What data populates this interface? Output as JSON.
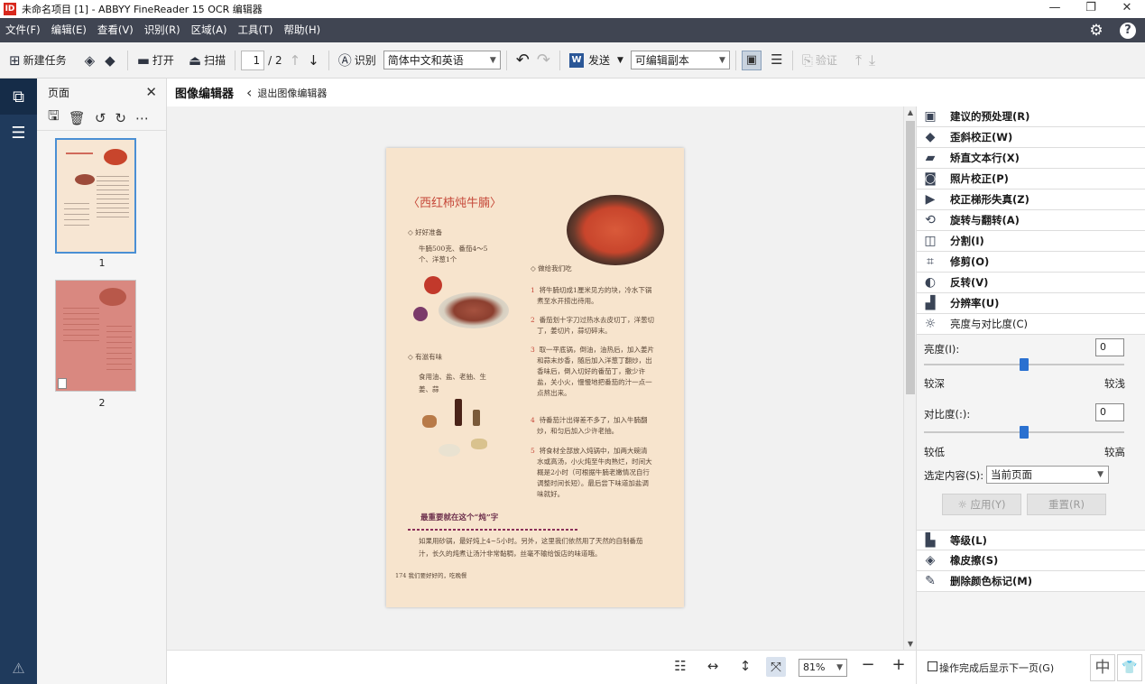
{
  "window": {
    "app_icon_label": "ID",
    "title": "未命名项目 [1] - ABBYY FineReader 15 OCR 编辑器",
    "minimize": "—",
    "restore": "❐",
    "close": "✕"
  },
  "menu": {
    "items": [
      "文件(F)",
      "编辑(E)",
      "查看(V)",
      "识别(R)",
      "区域(A)",
      "工具(T)",
      "帮助(H)"
    ],
    "settings_icon": "gear-icon",
    "help_icon": "help-icon",
    "help_glyph": "?"
  },
  "toolbar": {
    "new_task": "新建任务",
    "open": "打开",
    "scan": "扫描",
    "page_current": "1",
    "page_total": "/ 2",
    "recognize": "识别",
    "language": "简体中文和英语",
    "send": "发送",
    "send_target": "可编辑副本",
    "verify": "验证"
  },
  "pages_panel": {
    "title": "页面",
    "pages": [
      {
        "label": "1",
        "selected": true
      },
      {
        "label": "2",
        "selected": false
      }
    ]
  },
  "editor": {
    "title": "图像编辑器",
    "exit_label": "退出图像编辑器"
  },
  "document": {
    "title": "〈西红柿炖牛腩〉",
    "prep_heading": "◇ 好好准备",
    "prep_text_1": "牛腩500克、番茄4～5",
    "prep_text_2": "个、洋葱1个",
    "steps_heading": "◇ 做给我们吃",
    "seasoning_heading": "◇ 有滋有味",
    "seasoning_text_1": "食用油、盐、老抽、生",
    "seasoning_text_2": "姜、蒜",
    "steps": [
      {
        "n": "1",
        "lines": [
          "将牛腩切成1厘米见方的块，冷水下锅",
          "煮至水开捞出待用。"
        ]
      },
      {
        "n": "2",
        "lines": [
          "番茄划十字刀过热水去皮切丁，洋葱切",
          "丁，姜切片，蒜切碎末。"
        ]
      },
      {
        "n": "3",
        "lines": [
          "取一平底锅，倒油，油热后，加入姜片",
          "和蒜末炒香，随后加入洋葱丁翻炒，出",
          "香味后，倒入切好的番茄丁，撒少许",
          "盐，关小火，慢慢地把番茄的汁一点一",
          "点熬出来。"
        ]
      },
      {
        "n": "4",
        "lines": [
          "待番茄汁出得差不多了，加入牛腩翻",
          "炒，和匀后加入少许老抽。"
        ]
      },
      {
        "n": "5",
        "lines": [
          "将食材全部放入炖锅中，加两大碗清",
          "水或高汤，小火炖至牛肉熟烂，时间大",
          "概是2小时（可根据牛腩老嫩情况自行",
          "调整时间长短）。最后尝下味道加盐调",
          "味就好。"
        ]
      }
    ],
    "tip_heading": "最重要就在这个“炖”字",
    "tip_text_1": "如果用砂锅，最好炖上4~5小时。另外，这里我们依然用了天然的自制番茄",
    "tip_text_2": "汁，长久的炖煮让汤汁非常黏稠，丝毫不输给饭店的味道哦。",
    "footer": "174  我们要好好的，吃晚餐"
  },
  "right_panel": {
    "items_top": [
      {
        "icon": "preprocess-icon",
        "glyph": "▣",
        "label": "建议的预处理(R)"
      },
      {
        "icon": "deskew-icon",
        "glyph": "◆",
        "label": "歪斜校正(W)"
      },
      {
        "icon": "straighten-icon",
        "glyph": "▰",
        "label": "矫直文本行(X)"
      },
      {
        "icon": "camera-icon",
        "glyph": "◙",
        "label": "照片校正(P)"
      },
      {
        "icon": "trapezoid-icon",
        "glyph": "▶",
        "label": "校正梯形失真(Z)"
      },
      {
        "icon": "rotate-icon",
        "glyph": "⟲",
        "label": "旋转与翻转(A)"
      },
      {
        "icon": "split-icon",
        "glyph": "◫",
        "label": "分割(I)"
      },
      {
        "icon": "crop-icon",
        "glyph": "⌗",
        "label": "修剪(O)"
      },
      {
        "icon": "invert-icon",
        "glyph": "◐",
        "label": "反转(V)"
      },
      {
        "icon": "resolution-icon",
        "glyph": "▟",
        "label": "分辨率(U)"
      },
      {
        "icon": "brightness-icon",
        "glyph": "☼",
        "label": "亮度与对比度(C)"
      }
    ],
    "brightness": {
      "label": "亮度(I):",
      "value": "0",
      "level": 0.5,
      "min_label": "较深",
      "max_label": "较浅"
    },
    "contrast": {
      "label": "对比度(:):",
      "value": "0",
      "level": 0.5,
      "min_label": "较低",
      "max_label": "较高"
    },
    "selection": {
      "label": "选定内容(S):",
      "value": "当前页面"
    },
    "apply": "应用(Y)",
    "reset": "重置(R)",
    "items_bottom": [
      {
        "icon": "levels-icon",
        "glyph": "▙",
        "label": "等级(L)"
      },
      {
        "icon": "eraser-icon",
        "glyph": "◈",
        "label": "橡皮擦(S)"
      },
      {
        "icon": "remove-color-icon",
        "glyph": "✎",
        "label": "删除颜色标记(M)"
      }
    ]
  },
  "statusbar": {
    "zoom": "81%",
    "next_page_option": "操作完成后显示下一页(G)",
    "ime_lang": "中",
    "ime_mode": "👕"
  },
  "colors": {
    "menubar": "#404552",
    "rail": "#1f3a5c",
    "accent": "#2a71d0"
  }
}
